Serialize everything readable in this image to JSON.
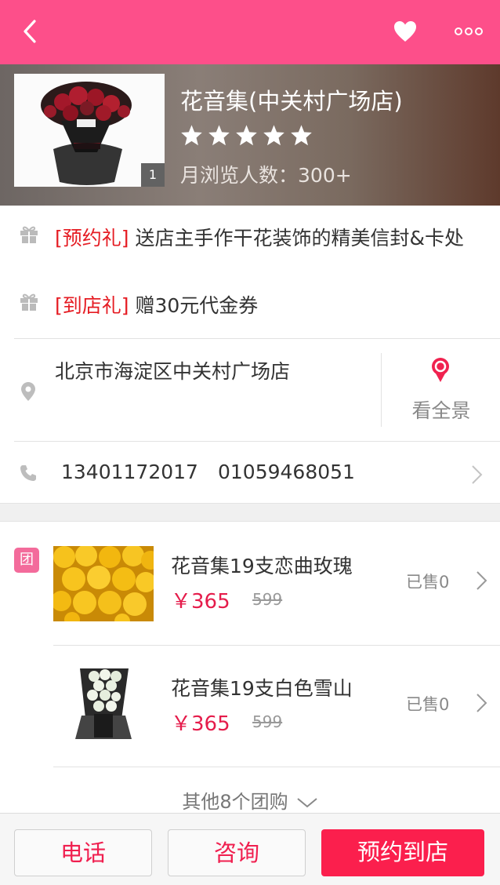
{
  "topbar": {
    "background": "#fd4f8a",
    "back_icon": "chevron-left-icon",
    "favorite_icon": "heart-icon",
    "more_icon": "more-dots-icon"
  },
  "shop": {
    "name": "花音集(中关村广场店)",
    "photo_count": "1",
    "rating_stars": 5,
    "views_label": "月浏览人数：",
    "views_value": "300+"
  },
  "gifts": [
    {
      "tag": "[预约礼]",
      "text": " 送店主手作干花装饰的精美信封&卡处"
    },
    {
      "tag": "[到店礼]",
      "text": " 赠30元代金券"
    }
  ],
  "address": {
    "text": "北京市海淀区中关村广场店",
    "panorama_label": "看全景"
  },
  "phone": {
    "numbers": [
      "13401172017",
      "01059468051"
    ]
  },
  "deals_badge": "团",
  "deals": [
    {
      "title": "花音集19支恋曲玫瑰",
      "currency": "￥",
      "price": "365",
      "original_price": "599",
      "sold": "已售0",
      "image": "yellow-roses"
    },
    {
      "title": "花音集19支白色雪山",
      "currency": "￥",
      "price": "365",
      "original_price": "599",
      "sold": "已售0",
      "image": "white-roses-bouquet"
    }
  ],
  "more_deals_label": "其他8个团购",
  "bottom": {
    "call_label": "电话",
    "consult_label": "咨询",
    "book_label": "预约到店"
  },
  "colors": {
    "accent_pink": "#fd4f8a",
    "price_red": "#e51c4b",
    "tag_red": "#e51c23",
    "book_button": "#fb1f4d"
  }
}
